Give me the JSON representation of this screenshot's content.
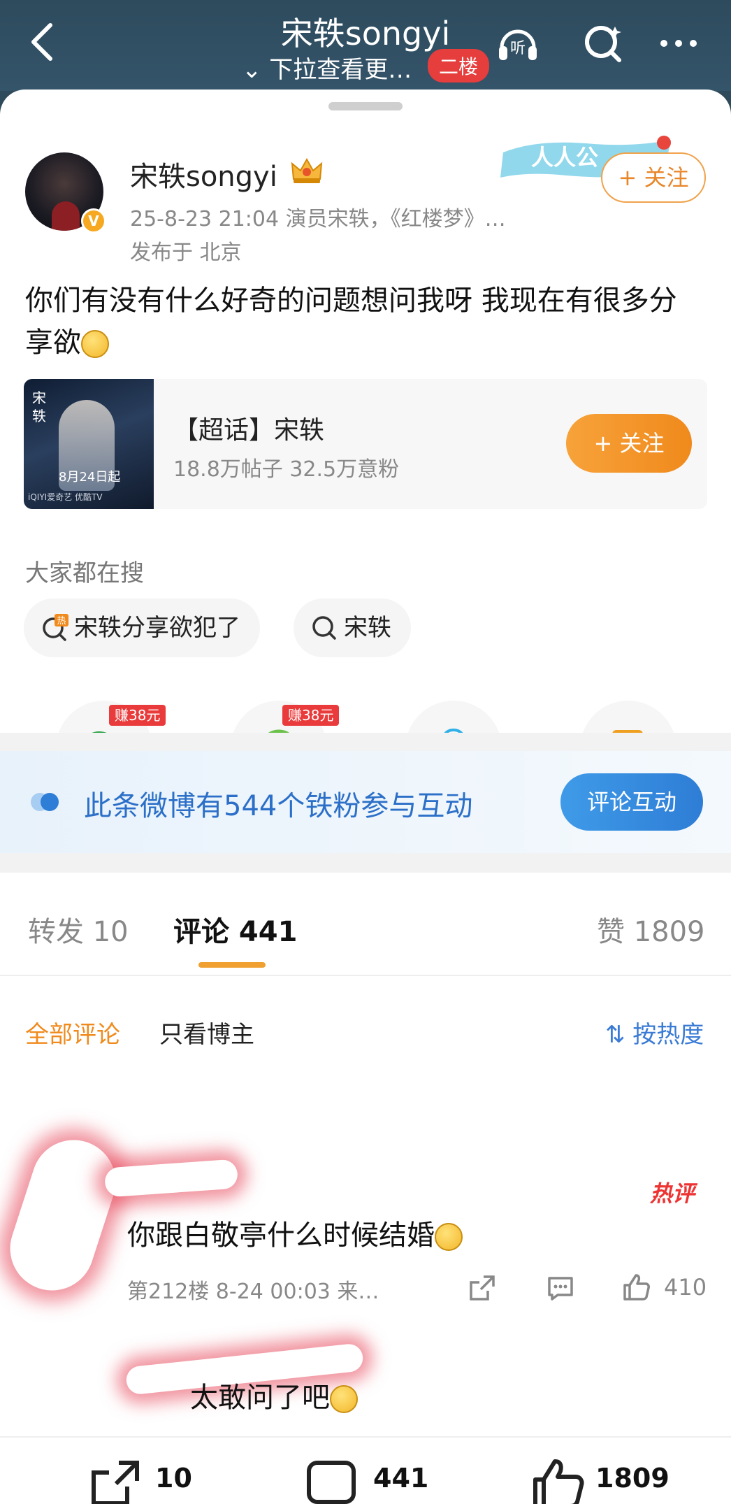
{
  "header": {
    "title": "宋轶songyi",
    "subtitle": "下拉查看更…",
    "floor_badge": "二楼"
  },
  "post": {
    "author": "宋轶songyi",
    "meta_line": "25-8-23 21:04  演员宋轶，《红楼梦》…",
    "location": "发布于 北京",
    "follow_label": "+ 关注",
    "deco_text": "人人公",
    "text": "你们有没有什么好奇的问题想问我呀 我现在有很多分享欲"
  },
  "topic": {
    "title": "【超话】宋轶",
    "stats": "18.8万帖子 32.5万意粉",
    "follow_label": "+ 关注",
    "poster_date": "8月24日起",
    "poster_brand": "iQIYI爱奇艺  优酷TV",
    "poster_vertical": "宋轶"
  },
  "search": {
    "heading": "大家都在搜",
    "chips": [
      "宋轶分享欲犯了",
      "宋轶"
    ]
  },
  "share": {
    "earn_label": "赚38元"
  },
  "fans": {
    "text": "此条微博有544个铁粉参与互动",
    "button": "评论互动"
  },
  "tabs": {
    "repost": "转发 10",
    "comment": "评论 441",
    "like": "赞 1809"
  },
  "filters": {
    "all": "全部评论",
    "author_only": "只看博主",
    "sort": "按热度"
  },
  "comment1": {
    "text": "你跟白敬亭什么时候结婚",
    "meta": "第212楼 8-24 00:03 来…",
    "likes": "410",
    "hot_label": "热评"
  },
  "reply1": {
    "text": "太敢问了吧"
  },
  "bottom": {
    "repost_count": "10",
    "comment_count": "441",
    "like_count": "1809"
  },
  "colors": {
    "accent_orange": "#f08a1c",
    "link_blue": "#2b6fc8",
    "header_bg": "#2f4a5a"
  }
}
